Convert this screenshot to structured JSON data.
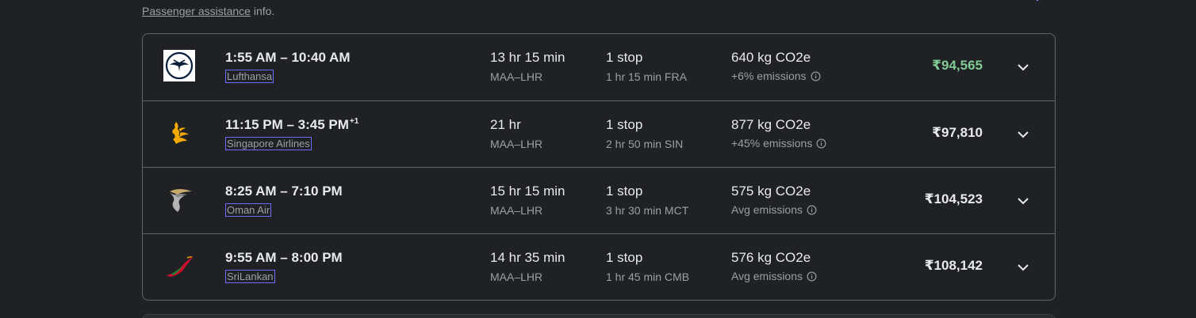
{
  "assistance": {
    "link_text": "Passenger assistance",
    "suffix": " info."
  },
  "flights": [
    {
      "airline": "Lufthansa",
      "logo_icon": "lufthansa-crane-logo",
      "departure": "1:55 AM",
      "arrival": "10:40 AM",
      "day_offset": "",
      "duration": "13 hr 15 min",
      "route": "MAA–LHR",
      "stops": "1 stop",
      "layover": "1 hr 15 min FRA",
      "co2": "640 kg CO2e",
      "emissions": "+6% emissions",
      "price": "₹94,565",
      "price_color": "#81c995"
    },
    {
      "airline": "Singapore Airlines",
      "logo_icon": "singapore-airlines-bird-logo",
      "departure": "11:15 PM",
      "arrival": "3:45 PM",
      "day_offset": "+1",
      "duration": "21 hr",
      "route": "MAA–LHR",
      "stops": "1 stop",
      "layover": "2 hr 50 min SIN",
      "co2": "877 kg CO2e",
      "emissions": "+45% emissions",
      "price": "₹97,810",
      "price_color": "#e8eaed"
    },
    {
      "airline": "Oman Air",
      "logo_icon": "oman-air-logo",
      "departure": "8:25 AM",
      "arrival": "7:10 PM",
      "day_offset": "",
      "duration": "15 hr 15 min",
      "route": "MAA–LHR",
      "stops": "1 stop",
      "layover": "3 hr 30 min MCT",
      "co2": "575 kg CO2e",
      "emissions": "Avg emissions",
      "price": "₹104,523",
      "price_color": "#e8eaed"
    },
    {
      "airline": "SriLankan",
      "logo_icon": "srilankan-peacock-logo",
      "departure": "9:55 AM",
      "arrival": "8:00 PM",
      "day_offset": "",
      "duration": "14 hr 35 min",
      "route": "MAA–LHR",
      "stops": "1 stop",
      "layover": "1 hr 45 min CMB",
      "co2": "576 kg CO2e",
      "emissions": "Avg emissions",
      "price": "₹108,142",
      "price_color": "#e8eaed"
    }
  ],
  "time_separator": " – "
}
